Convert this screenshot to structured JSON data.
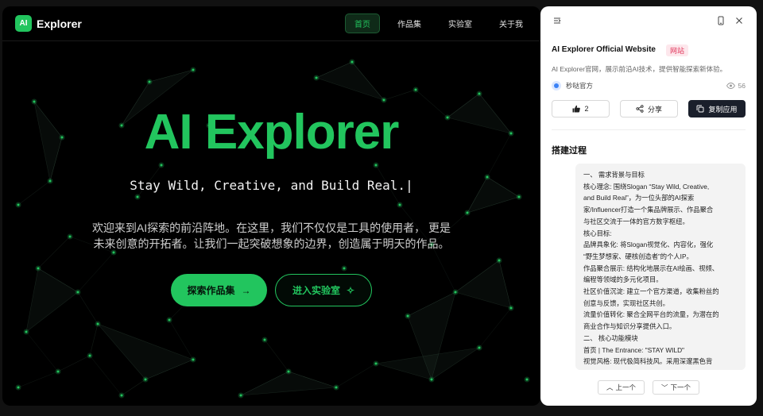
{
  "preview": {
    "logo_badge": "AI",
    "logo_text": "Explorer",
    "nav": [
      {
        "label": "首页"
      },
      {
        "label": "作品集"
      },
      {
        "label": "实验室"
      },
      {
        "label": "关于我"
      }
    ],
    "hero_title": "AI Explorer",
    "hero_slogan": "Stay Wild, Creative, and Build Real.|",
    "hero_desc": "欢迎来到AI探索的前沿阵地。在这里，我们不仅仅是工具的使用者， 更是未来创意的开拓者。让我们一起突破想象的边界，创造属于明天的作品。",
    "cta_primary": "探索作品集",
    "cta_primary_icon": "→",
    "cta_secondary": "进入实验室",
    "cta_secondary_icon": "✧",
    "accent_color": "#22c55e"
  },
  "panel": {
    "site_title": "AI Explorer Official Website",
    "site_badge": "网站",
    "site_desc": "AI Explorer官网，展示前沿AI技术，提供智能探索新体验。",
    "author": "秒哒官方",
    "views": "56",
    "like_count": "2",
    "share_label": "分享",
    "copy_label": "复制应用",
    "section_title": "搭建过程",
    "content_lines": [
      "一、 需求背景与目标",
      "核心理念: 围绕Slogan “Stay Wild, Creative,",
      "and Build Real”，为一位头部的AI探索",
      "家/Influencer打造一个集品牌展示、作品聚合",
      "与社区交流于一体的官方数字枢纽。",
      "核心目标:",
      "品牌具象化: 将Slogan视觉化、内容化，强化",
      "“野生梦想家、硬核创造者”的个人IP。",
      "作品聚合展示: 结构化地展示在AI绘画、视频、",
      "编程等领域的多元化项目。",
      "社区价值沉淀: 建立一个官方渠道，收集粉丝的",
      "创意与反馈，实现社区共创。",
      "流量价值转化: 聚合全网平台的流量，为潜在的",
      "商业合作与知识分享提供入口。",
      "二、 核心功能模块",
      "首页 | The Entrance: \"STAY WILD\"",
      "视觉风格: 现代极简科技风。采用深邃黑色背"
    ],
    "prev_label": "上一个",
    "next_label": "下一个"
  }
}
